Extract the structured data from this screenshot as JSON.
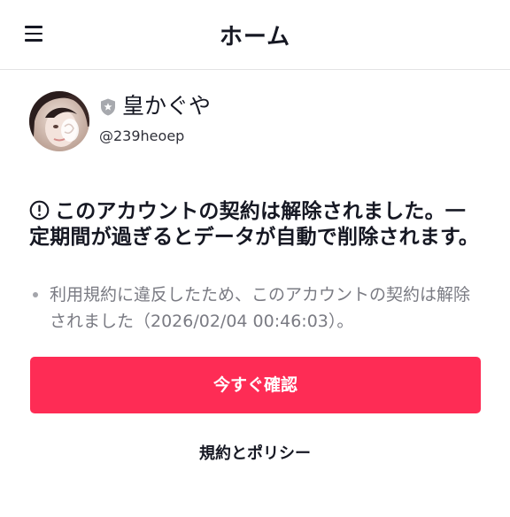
{
  "header": {
    "title": "ホーム",
    "menu_icon": "hamburger-menu-icon"
  },
  "profile": {
    "display_name": "皇かぐや",
    "handle": "@239heoep",
    "badge_icon": "shield-star-icon"
  },
  "notice": {
    "icon": "exclamation-circle-icon",
    "message": "このアカウントの契約は解除されました。一定期間が過ぎるとデータが自動で削除されます。",
    "reason": "利用規約に違反したため、このアカウントの契約は解除されました（2026/02/04 00:46:03）。"
  },
  "actions": {
    "confirm_label": "今すぐ確認",
    "policy_label": "規約とポリシー"
  },
  "colors": {
    "accent": "#fe2c55",
    "text": "#161823",
    "muted": "#7a7b83"
  }
}
